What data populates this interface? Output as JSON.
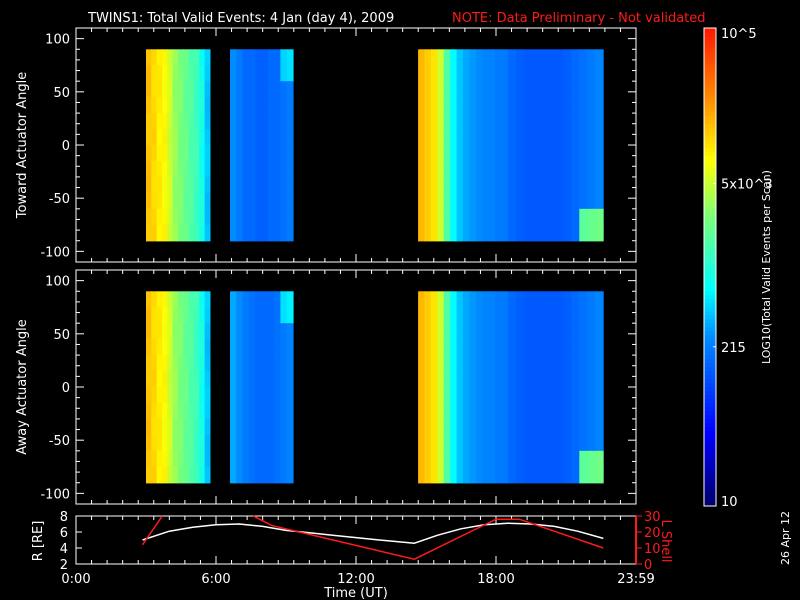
{
  "title": "TWINS1: Total Valid Events:  4 Jan (day   4), 2009",
  "note": "NOTE: Data Preliminary - Not validated",
  "date_stamp": "26 Apr 12",
  "colors": {
    "background": "#000000",
    "axis": "#ffffff",
    "note": "#ff0000",
    "lshell": "#ff0000",
    "radius": "#ffffff"
  },
  "chart_data": [
    {
      "type": "heatmap",
      "name": "toward",
      "ylabel": "Toward Actuator Angle",
      "ylim": [
        -110,
        110
      ],
      "yticks": [
        -100,
        -50,
        0,
        50,
        100
      ],
      "xlim": [
        0,
        24
      ],
      "angle_range": [
        -90,
        90
      ],
      "blocks": [
        {
          "start_h": 3.0,
          "end_h": 5.74,
          "log_counts": [
            4.15,
            4.05,
            3.95,
            3.9,
            3.7,
            3.5,
            3.4,
            3.3,
            3.2,
            3.1,
            2.9,
            2.6
          ]
        },
        {
          "start_h": 6.6,
          "end_h": 9.3,
          "log_counts": [
            2.4,
            2.3,
            2.2,
            2.2,
            2.15,
            2.15,
            2.2,
            2.2,
            2.25,
            2.3
          ]
        },
        {
          "start_h": 14.66,
          "end_h": 18.51,
          "log_counts": [
            4.2,
            4.1,
            4.0,
            3.7,
            3.2,
            2.8,
            2.6,
            2.5,
            2.45,
            2.4,
            2.35,
            2.35,
            2.3,
            2.3
          ]
        },
        {
          "start_h": 18.51,
          "end_h": 22.59,
          "log_counts": [
            2.2,
            2.15,
            2.1,
            2.1,
            2.1,
            2.1,
            2.1,
            2.15,
            2.2,
            2.25,
            2.3,
            2.35
          ]
        }
      ]
    },
    {
      "type": "heatmap",
      "name": "away",
      "ylabel": "Away Actuator Angle",
      "ylim": [
        -110,
        110
      ],
      "yticks": [
        -100,
        -50,
        0,
        50,
        100
      ],
      "xlim": [
        0,
        24
      ],
      "angle_range": [
        -90,
        90
      ],
      "blocks": [
        {
          "start_h": 3.0,
          "end_h": 5.74,
          "log_counts": [
            4.15,
            4.05,
            3.95,
            3.9,
            3.7,
            3.5,
            3.4,
            3.3,
            3.2,
            3.1,
            2.9,
            2.6
          ]
        },
        {
          "start_h": 6.6,
          "end_h": 9.3,
          "log_counts": [
            2.5,
            2.4,
            2.3,
            2.25,
            2.2,
            2.2,
            2.2,
            2.25,
            2.3,
            2.35
          ]
        },
        {
          "start_h": 14.66,
          "end_h": 18.51,
          "log_counts": [
            4.2,
            4.1,
            4.0,
            3.7,
            3.2,
            2.8,
            2.6,
            2.5,
            2.45,
            2.4,
            2.35,
            2.35,
            2.3,
            2.3
          ]
        },
        {
          "start_h": 18.51,
          "end_h": 22.59,
          "log_counts": [
            2.2,
            2.15,
            2.1,
            2.1,
            2.1,
            2.1,
            2.1,
            2.15,
            2.2,
            2.25,
            2.3,
            2.35
          ]
        }
      ]
    },
    {
      "type": "line",
      "name": "orbit",
      "ylabel": "R [RE]",
      "ylabel_right": "L Shell",
      "ylim": [
        2,
        8
      ],
      "yticks": [
        2,
        4,
        6,
        8
      ],
      "ylim_right": [
        0,
        30
      ],
      "yticks_right": [
        0,
        10,
        20,
        30
      ],
      "xlim": [
        0,
        24
      ],
      "series": [
        {
          "name": "R",
          "x": [
            2.85,
            4,
            5,
            6,
            7,
            8,
            9,
            10,
            11,
            12,
            13,
            14.5,
            15.5,
            16.5,
            17.5,
            18.5,
            19.5,
            20.5,
            21.5,
            22.6
          ],
          "y": [
            5.0,
            6.1,
            6.6,
            6.9,
            7.0,
            6.7,
            6.2,
            5.9,
            5.6,
            5.3,
            5.0,
            4.6,
            5.6,
            6.4,
            6.9,
            7.1,
            7.0,
            6.7,
            6.1,
            5.2
          ]
        },
        {
          "name": "L Shell",
          "x": [
            2.85,
            3.7,
            null,
            7.6,
            8.4,
            14.5,
            18.0,
            19.0,
            22.6
          ],
          "y": [
            12,
            30,
            null,
            30,
            24,
            3,
            28,
            28,
            10
          ]
        }
      ]
    },
    {
      "type": "colorbar",
      "label": "LOG10(Total Valid Events per Scan)",
      "log_range": [
        1,
        5
      ],
      "ticks": [
        {
          "value": 10,
          "label": "10"
        },
        {
          "value": 215,
          "label": "215"
        },
        {
          "value": 5000,
          "label": "5x10^3"
        },
        {
          "value": 100000,
          "label": "10^5"
        }
      ]
    }
  ],
  "xaxis": {
    "label": "Time (UT)",
    "ticks": [
      {
        "h": 0,
        "label": "0:00"
      },
      {
        "h": 6,
        "label": "6:00"
      },
      {
        "h": 12,
        "label": "12:00"
      },
      {
        "h": 18,
        "label": "18:00"
      },
      {
        "h": 24,
        "label": "23:59"
      }
    ]
  }
}
